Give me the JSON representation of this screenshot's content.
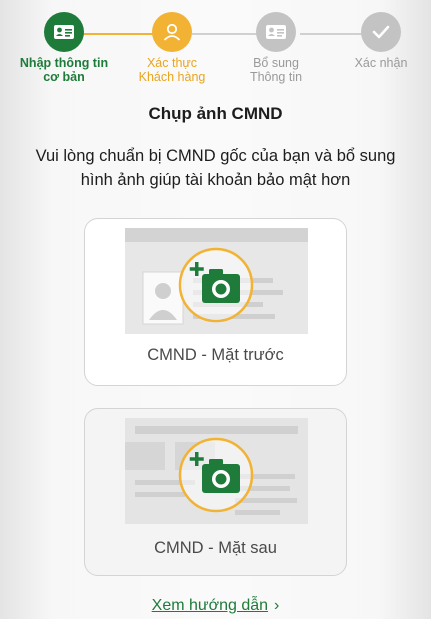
{
  "stepper": {
    "steps": [
      {
        "label_line1": "Nhập thông tin",
        "label_line2": "cơ bản",
        "state": "done",
        "icon": "id-card-icon"
      },
      {
        "label_line1": "Xác thực",
        "label_line2": "Khách hàng",
        "state": "active",
        "icon": "user-icon"
      },
      {
        "label_line1": "Bổ sung",
        "label_line2": "Thông tin",
        "state": "pending",
        "icon": "id-card-icon"
      },
      {
        "label_line1": "Xác nhận",
        "label_line2": "",
        "state": "pending",
        "icon": "check-icon"
      }
    ]
  },
  "page": {
    "title": "Chụp ảnh CMND",
    "description": "Vui lòng chuẩn bị CMND gốc của bạn và bổ sung hình ảnh giúp tài khoản bảo mật hơn"
  },
  "cards": {
    "front_label": "CMND - Mặt trước",
    "back_label": "CMND - Mặt sau"
  },
  "guide_link": {
    "label": "Xem hướng dẫn",
    "chevron": "›"
  },
  "colors": {
    "primary_green": "#1e7b3a",
    "active_orange": "#f2b233",
    "pending_gray": "#c3c3c3"
  }
}
